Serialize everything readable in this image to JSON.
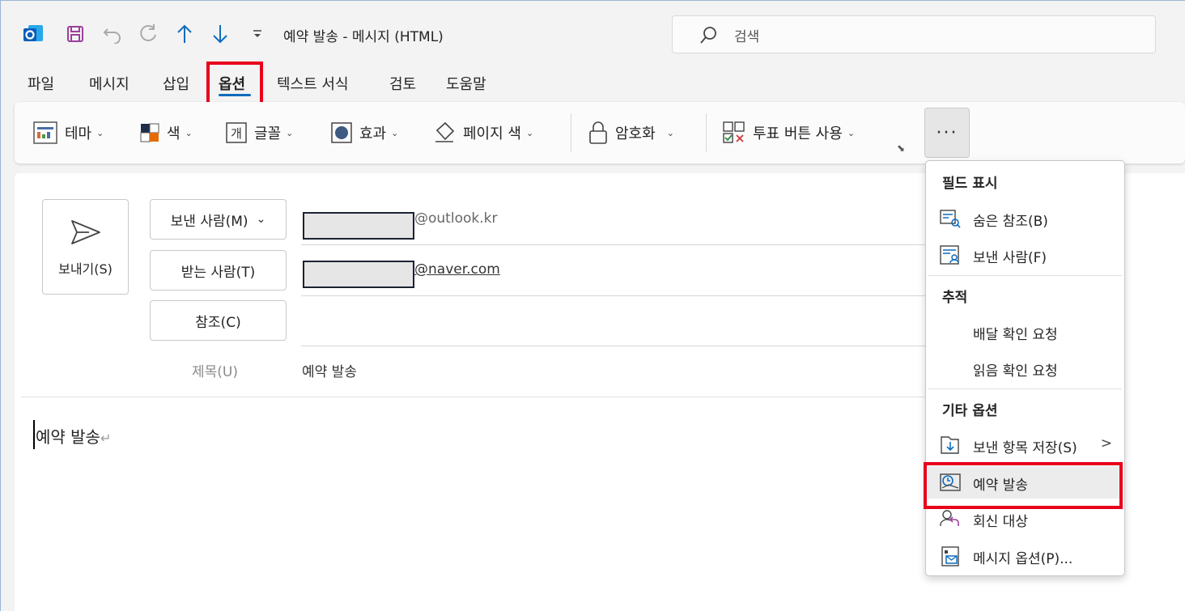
{
  "titlebar": {
    "title": "예약 발송 - 메시지 (HTML)",
    "search_placeholder": "검색",
    "icons": [
      "outlook-app-icon",
      "save-icon",
      "undo-icon",
      "redo-icon",
      "up-arrow-icon",
      "down-arrow-icon",
      "customize-qat-icon"
    ]
  },
  "tabs": [
    {
      "label": "파일"
    },
    {
      "label": "메시지"
    },
    {
      "label": "삽입"
    },
    {
      "label": "옵션",
      "active": true
    },
    {
      "label": "텍스트 서식"
    },
    {
      "label": "검토"
    },
    {
      "label": "도움말"
    }
  ],
  "ribbon": {
    "theme": "테마",
    "color": "색",
    "font": "글꼴",
    "effects": "효과",
    "page_color": "페이지 색",
    "encrypt": "암호화",
    "voting": "투표 버튼 사용",
    "more": "···"
  },
  "compose": {
    "send": "보내기(S)",
    "from_btn": "보낸 사람(M)",
    "to_btn": "받는 사람(T)",
    "cc_btn": "참조(C)",
    "subject_label": "제목(U)",
    "from_domain": "@outlook.kr",
    "to_domain": "@naver.com",
    "subject_value": "예약 발송",
    "body_text": "예약 발송",
    "body_mark": "↵"
  },
  "menu": {
    "section_fields": "필드 표시",
    "bcc": "숨은 참조(B)",
    "from": "보낸 사람(F)",
    "section_tracking": "추적",
    "delivery_receipt": "배달 확인 요청",
    "read_receipt": "읽음 확인 요청",
    "section_other": "기타 옵션",
    "save_sent": "보낸 항목 저장(S)",
    "delay_delivery": "예약 발송",
    "reply_to": "회신 대상",
    "message_options": "메시지 옵션(P)..."
  },
  "colors": {
    "accent": "#0f6cbd",
    "highlight_box": "#e8001c",
    "outlook_blue": "#0a5eb8",
    "save_purple": "#9b3f9b"
  }
}
